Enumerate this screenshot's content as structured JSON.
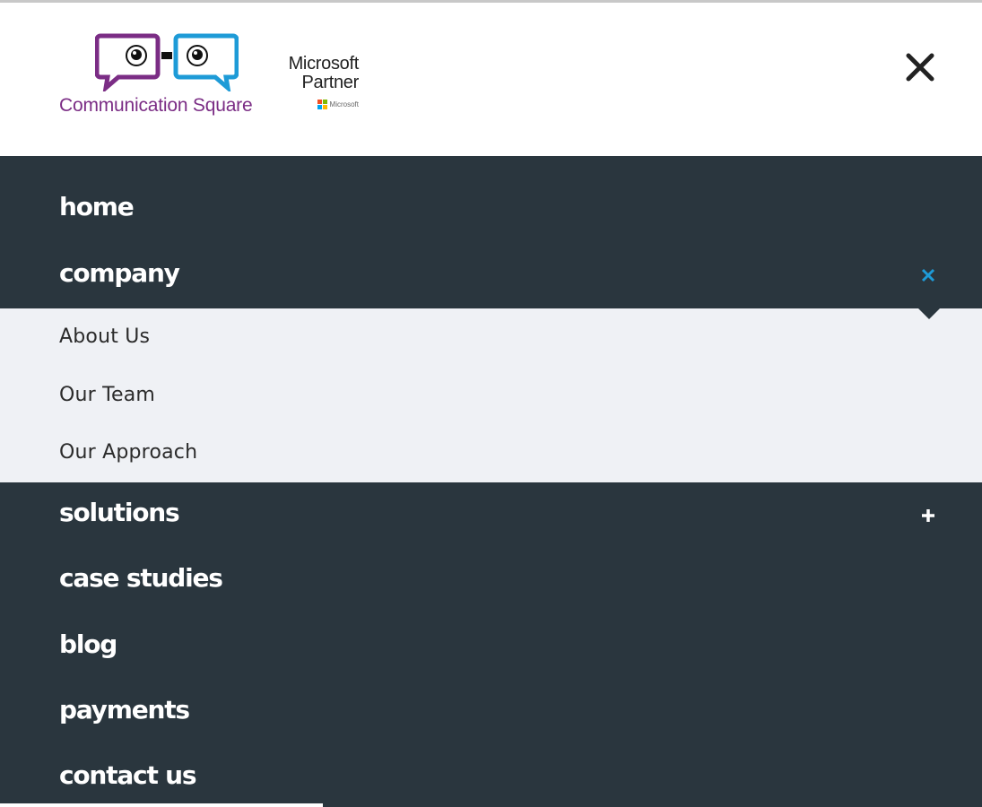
{
  "logo": {
    "brand": "Communication Square",
    "partner_line1": "Microsoft",
    "partner_line2": "Partner",
    "partner_small": "Microsoft"
  },
  "colors": {
    "dark_bg": "#2a363e",
    "submenu_bg": "#eff1f5",
    "accent_blue": "#1e9bd7",
    "brand_purple": "#7b2d85"
  },
  "header": {
    "close_icon": "close-icon"
  },
  "menu": {
    "items": [
      {
        "label": "home"
      },
      {
        "label": "company",
        "expanded": true,
        "toggle_icon": "collapse-x-icon"
      },
      {
        "label": "solutions",
        "expanded": false,
        "toggle_icon": "plus-icon"
      },
      {
        "label": "case studies"
      },
      {
        "label": "blog"
      },
      {
        "label": "payments"
      },
      {
        "label": "contact us"
      }
    ],
    "company_submenu": [
      {
        "label": "About Us"
      },
      {
        "label": "Our Team"
      },
      {
        "label": "Our Approach"
      }
    ]
  }
}
